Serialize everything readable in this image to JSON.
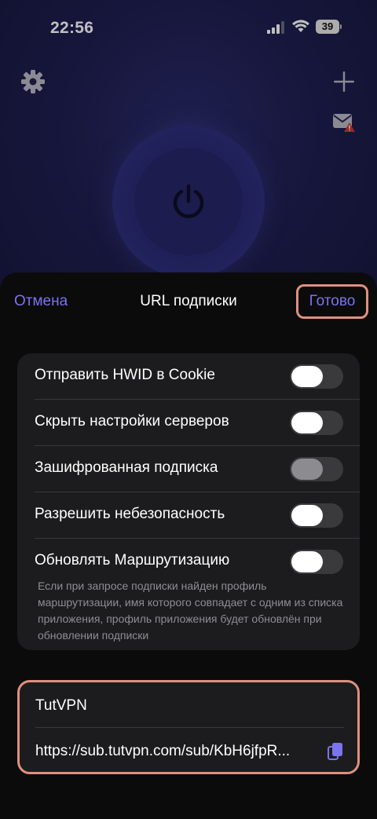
{
  "status_bar": {
    "time": "22:56",
    "battery": "39"
  },
  "header_icons": {
    "settings": "gear-icon",
    "add": "plus-icon",
    "mail": "mail-alert-icon",
    "connect": "power-icon"
  },
  "sheet": {
    "cancel_label": "Отмена",
    "title": "URL подписки",
    "done_label": "Готово"
  },
  "options": [
    {
      "label": "Отправить HWID в Cookie",
      "enabled": false,
      "disabled": false
    },
    {
      "label": "Скрыть настройки серверов",
      "enabled": false,
      "disabled": false
    },
    {
      "label": "Зашифрованная подписка",
      "enabled": false,
      "disabled": true
    },
    {
      "label": "Разрешить небезопасность",
      "enabled": false,
      "disabled": false
    },
    {
      "label": "Обновлять Маршрутизацию",
      "enabled": false,
      "disabled": false
    }
  ],
  "routing_note": "Если при запросе подписки найден профиль маршрутизации, имя которого совпадает с одним из списка приложения, профиль приложения будет обновлён при обновлении подписки",
  "subscription": {
    "name": "TutVPN",
    "url": "https://sub.tutvpn.com/sub/KbH6jfpR..."
  },
  "colors": {
    "accent": "#7b73f0",
    "highlight_border": "#e0907e",
    "card_background": "#1c1c1e",
    "background_app": "#1f1f52"
  }
}
